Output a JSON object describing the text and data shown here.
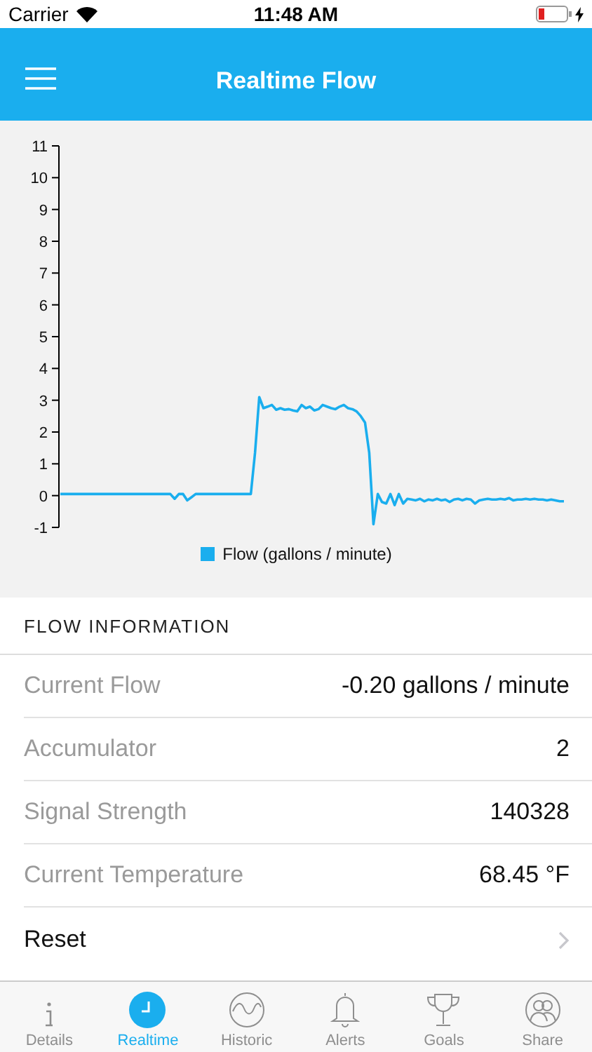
{
  "status_bar": {
    "carrier": "Carrier",
    "time": "11:48 AM"
  },
  "nav_bar": {
    "title": "Realtime Flow"
  },
  "chart": {
    "chart_data": {
      "type": "line",
      "ylim": [
        -1,
        11
      ],
      "yticks": [
        -1,
        0,
        1,
        2,
        3,
        4,
        5,
        6,
        7,
        8,
        9,
        10,
        11
      ],
      "series": [
        {
          "name": "Flow (gallons / minute)",
          "color": "#1aaeee",
          "values": [
            0.05,
            0.05,
            0.05,
            0.05,
            0.05,
            0.05,
            0.05,
            0.05,
            0.05,
            0.05,
            0.05,
            0.05,
            0.05,
            0.05,
            0.05,
            0.05,
            0.05,
            0.05,
            0.05,
            0.05,
            0.05,
            0.05,
            0.05,
            0.05,
            0.05,
            0.05,
            0.05,
            -0.1,
            0.05,
            0.05,
            -0.15,
            -0.05,
            0.05,
            0.05,
            0.05,
            0.05,
            0.05,
            0.05,
            0.05,
            0.05,
            0.05,
            0.05,
            0.05,
            0.05,
            0.05,
            0.05,
            1.35,
            3.1,
            2.75,
            2.8,
            2.85,
            2.7,
            2.75,
            2.7,
            2.72,
            2.68,
            2.65,
            2.85,
            2.75,
            2.8,
            2.68,
            2.72,
            2.85,
            2.8,
            2.75,
            2.72,
            2.8,
            2.85,
            2.75,
            2.72,
            2.65,
            2.5,
            2.3,
            1.35,
            -0.9,
            0.05,
            -0.2,
            -0.25,
            0.05,
            -0.3,
            0.05,
            -0.25,
            -0.1,
            -0.12,
            -0.15,
            -0.1,
            -0.18,
            -0.12,
            -0.15,
            -0.1,
            -0.15,
            -0.12,
            -0.2,
            -0.12,
            -0.1,
            -0.15,
            -0.1,
            -0.12,
            -0.25,
            -0.15,
            -0.12,
            -0.1,
            -0.12,
            -0.12,
            -0.1,
            -0.12,
            -0.08,
            -0.15,
            -0.12,
            -0.12,
            -0.1,
            -0.12,
            -0.1,
            -0.12,
            -0.12,
            -0.15,
            -0.12,
            -0.15,
            -0.18,
            -0.18
          ]
        }
      ]
    }
  },
  "section": {
    "title": "FLOW INFORMATION"
  },
  "rows": [
    {
      "label": "Current Flow",
      "value": "-0.20 gallons / minute"
    },
    {
      "label": "Accumulator",
      "value": "2"
    },
    {
      "label": "Signal Strength",
      "value": "140328"
    },
    {
      "label": "Current Temperature",
      "value": "68.45 °F"
    }
  ],
  "action_row": {
    "label": "Reset"
  },
  "tabs": [
    {
      "label": "Details",
      "selected": false
    },
    {
      "label": "Realtime",
      "selected": true
    },
    {
      "label": "Historic",
      "selected": false
    },
    {
      "label": "Alerts",
      "selected": false
    },
    {
      "label": "Goals",
      "selected": false
    },
    {
      "label": "Share",
      "selected": false
    }
  ]
}
